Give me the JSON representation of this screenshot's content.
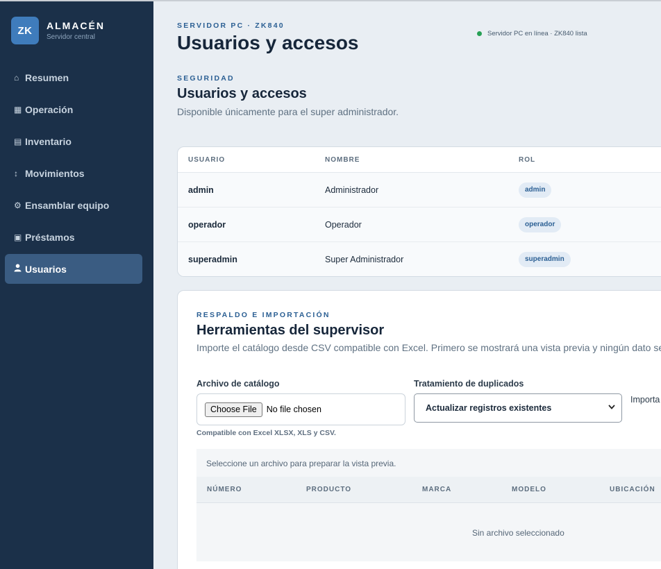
{
  "brand": {
    "logo": "ZK",
    "title": "ALMACÉN",
    "subtitle": "Servidor central"
  },
  "nav": {
    "items": [
      {
        "icon": "home-icon",
        "glyph": "⌂",
        "label": "Resumen"
      },
      {
        "icon": "grid-icon",
        "glyph": "▦",
        "label": "Operación"
      },
      {
        "icon": "list-icon",
        "glyph": "▤",
        "label": "Inventario"
      },
      {
        "icon": "updown-arrow-icon",
        "glyph": "↕",
        "label": "Movimientos"
      },
      {
        "icon": "gear-icon",
        "glyph": "⚙",
        "label": "Ensamblar equipo"
      },
      {
        "icon": "box-icon",
        "glyph": "▣",
        "label": "Préstamos"
      },
      {
        "icon": "user-icon",
        "glyph": "👤",
        "label": "Usuarios",
        "active": true
      }
    ]
  },
  "header": {
    "eyebrow": "SERVIDOR PC · ZK840",
    "title": "Usuarios y accesos",
    "status": "Servidor PC en línea · ZK840 lista",
    "status_color": "#27a055"
  },
  "security": {
    "eyebrow": "SEGURIDAD",
    "title": "Usuarios y accesos",
    "description": "Disponible únicamente para el super administrador."
  },
  "users_table": {
    "columns": [
      "USUARIO",
      "NOMBRE",
      "ROL"
    ],
    "rows": [
      {
        "user": "admin",
        "name": "Administrador",
        "role": "admin"
      },
      {
        "user": "operador",
        "name": "Operador",
        "role": "operador"
      },
      {
        "user": "superadmin",
        "name": "Super Administrador",
        "role": "superadmin"
      }
    ]
  },
  "tools": {
    "eyebrow": "RESPALDO E IMPORTACIÓN",
    "title": "Herramientas del supervisor",
    "description": "Importe el catálogo desde CSV compatible con Excel. Primero se mostrará una vista previa y ningún dato se",
    "file_label": "Archivo de catálogo",
    "file_button": "Choose File",
    "file_status": "No file chosen",
    "duplicates_label": "Tratamiento de duplicados",
    "duplicates_value": "Actualizar registros existentes",
    "import_label": "Importa",
    "hint": "Compatible con Excel XLSX, XLS y CSV.",
    "preview_message": "Seleccione un archivo para preparar la vista previa.",
    "preview_columns": [
      "NÚMERO",
      "PRODUCTO",
      "MARCA",
      "MODELO",
      "UBICACIÓN"
    ],
    "preview_empty": "Sin archivo seleccionado"
  },
  "colors": {
    "sidebar": "#1b3049",
    "accent": "#2b5f93",
    "active_nav": "#3a5c82",
    "logo": "#3f7cbc"
  }
}
